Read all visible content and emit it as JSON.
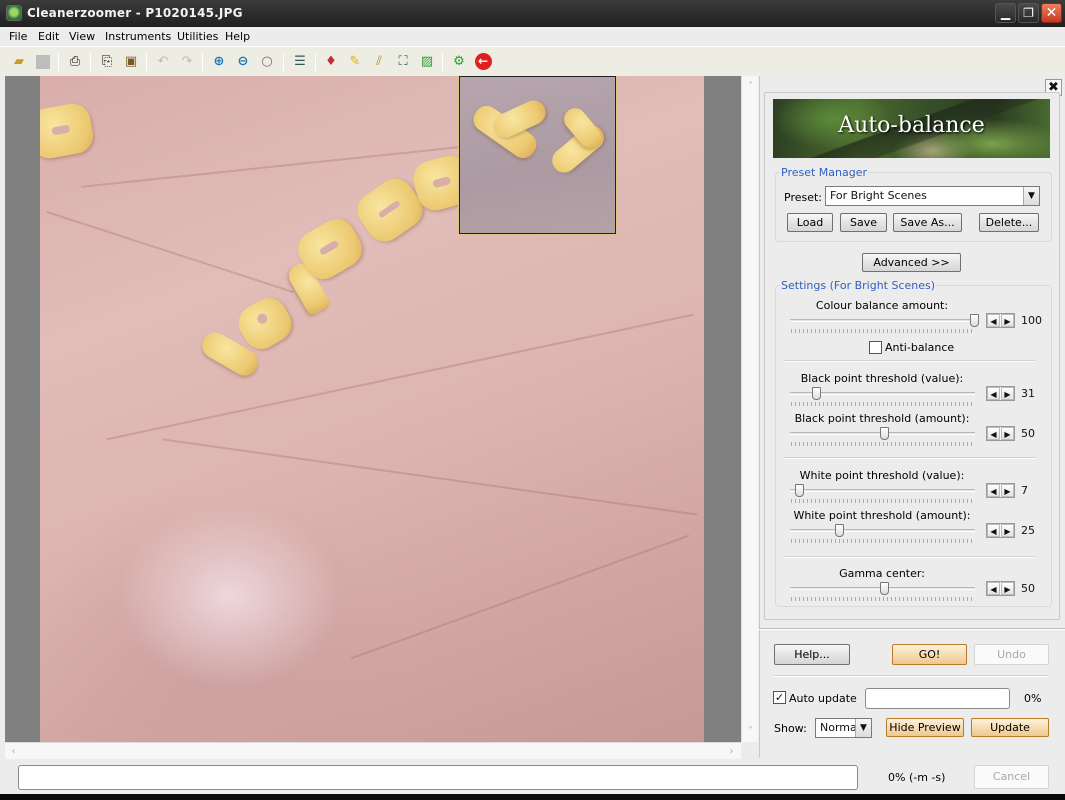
{
  "window": {
    "title": "Cleanerzoomer - P1020145.JPG",
    "icons": {
      "app": "app-icon",
      "minimize": "minimize-icon",
      "restore": "restore-icon",
      "close": "close-icon"
    }
  },
  "menu": [
    "File",
    "Edit",
    "View",
    "Instruments",
    "Utilities",
    "Help"
  ],
  "toolbar": [
    {
      "name": "open-folder-icon",
      "glyph": "📂",
      "enabled": true
    },
    {
      "name": "save-icon",
      "glyph": "■",
      "enabled": false
    },
    {
      "name": "print-icon",
      "glyph": "🖶",
      "enabled": true
    },
    {
      "name": "copy-icon",
      "glyph": "⎘",
      "enabled": true
    },
    {
      "name": "paste-icon",
      "glyph": "📋",
      "enabled": true
    },
    {
      "name": "undo-icon",
      "glyph": "↶",
      "enabled": false
    },
    {
      "name": "redo-icon",
      "glyph": "↷",
      "enabled": false
    },
    {
      "name": "zoom-in-icon",
      "glyph": "⊕",
      "enabled": true
    },
    {
      "name": "zoom-out-icon",
      "glyph": "⊖",
      "enabled": true
    },
    {
      "name": "zoom-icon",
      "glyph": "○",
      "enabled": true
    },
    {
      "name": "levels-icon",
      "glyph": "☰",
      "enabled": true
    },
    {
      "name": "color-drop-icon",
      "glyph": "💧",
      "enabled": true
    },
    {
      "name": "brush-clean-icon",
      "glyph": "🧹",
      "enabled": true
    },
    {
      "name": "sharpen-icon",
      "glyph": "⁄⁄",
      "enabled": true
    },
    {
      "name": "fit-screen-icon",
      "glyph": "⛶",
      "enabled": true
    },
    {
      "name": "image-view-icon",
      "glyph": "▨",
      "enabled": true
    },
    {
      "name": "gears-icon",
      "glyph": "⚙",
      "enabled": true
    },
    {
      "name": "back-arrow-icon",
      "glyph": "←",
      "enabled": true
    }
  ],
  "image": {
    "filename": "P1020145.JPG",
    "subject": "pasta letters on palm spelling UPTODOWN"
  },
  "panel": {
    "title": "Auto-balance",
    "preset_manager": {
      "label": "Preset Manager",
      "preset_label": "Preset:",
      "preset_value": "For Bright Scenes",
      "buttons": {
        "load": "Load",
        "save": "Save",
        "save_as": "Save As...",
        "delete": "Delete..."
      }
    },
    "advanced": "Advanced >>",
    "settings": {
      "label": "Settings (For Bright Scenes)",
      "sliders": [
        {
          "label": "Colour balance amount:",
          "value": 100,
          "min": 0,
          "max": 100
        },
        {
          "label": "Black point threshold (value):",
          "value": 31,
          "min": 0,
          "max": 255
        },
        {
          "label": "Black point threshold (amount):",
          "value": 50,
          "min": 0,
          "max": 100
        },
        {
          "label": "White point threshold (value):",
          "value": 7,
          "min": 0,
          "max": 255
        },
        {
          "label": "White point threshold (amount):",
          "value": 25,
          "min": 0,
          "max": 100
        },
        {
          "label": "Gamma center:",
          "value": 50,
          "min": 0,
          "max": 100
        }
      ],
      "anti_balance": {
        "label": "Anti-balance",
        "checked": false
      }
    },
    "help": "Help...",
    "go": "GO!",
    "undo": "Undo",
    "auto_update": {
      "label": "Auto update",
      "checked": true
    },
    "progress_text": "0%",
    "progress": 0,
    "show_label": "Show:",
    "show_value": "Normal",
    "hide_preview": "Hide Preview",
    "update": "Update"
  },
  "status": {
    "progress_text": "0% (-m -s)",
    "progress": 0,
    "cancel": "Cancel"
  }
}
